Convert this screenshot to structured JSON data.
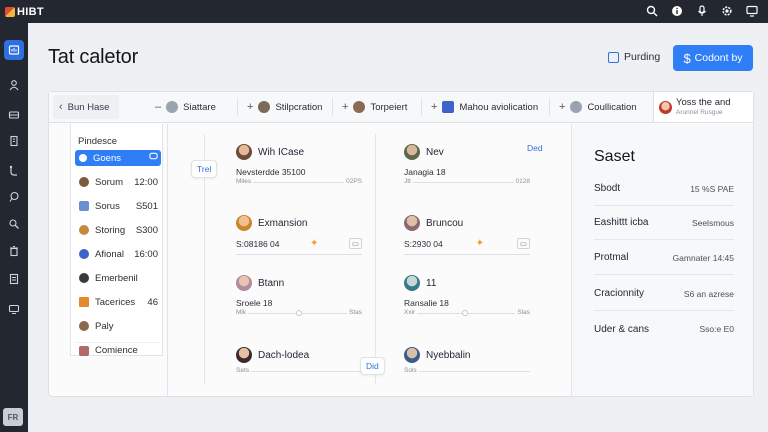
{
  "app": {
    "brand": "HIBT"
  },
  "topbar_icons": [
    "search-icon",
    "info-icon",
    "microphone-icon",
    "settings-icon",
    "monitor-icon"
  ],
  "rail": {
    "items": [
      "dashboard-icon",
      "user-icon",
      "inbox-icon",
      "building-icon",
      "route-icon",
      "chat-icon",
      "search-people-icon",
      "trash-icon",
      "document-icon",
      "display-icon"
    ],
    "bottom_label": "FR"
  },
  "header": {
    "title": "Tat caletor",
    "pending_label": "Purding",
    "primary_button": "Codont by"
  },
  "tabs": [
    {
      "label": "Bun Hase",
      "icon": "none"
    },
    {
      "label": "Siattare",
      "icon": "avatar"
    },
    {
      "label": "Stilpcration",
      "icon": "avatar"
    },
    {
      "label": "Torpeiert",
      "icon": "avatar"
    },
    {
      "label": "Mahou aviolication",
      "icon": "avatar"
    },
    {
      "label": "Coullication",
      "icon": "none"
    }
  ],
  "tab_active": {
    "title": "Yoss the and",
    "subtitle": "Arunnel Rusgue"
  },
  "list": {
    "title": "Pindesce",
    "items": [
      {
        "label": "Goens",
        "value": "",
        "active": true,
        "color": "#ffffff"
      },
      {
        "label": "Sorum",
        "value": "12:00",
        "active": false,
        "color": "#7a5a3a"
      },
      {
        "label": "Sorus",
        "value": "S501",
        "active": false,
        "color": "#6a8fd0"
      },
      {
        "label": "Storing",
        "value": "S300",
        "active": false,
        "color": "#c58a3a"
      },
      {
        "label": "Afional",
        "value": "16:00",
        "active": false,
        "color": "#3d64c8"
      },
      {
        "label": "Emerbenil",
        "value": "",
        "active": false,
        "color": "#3a3a3a"
      },
      {
        "label": "Tacerices",
        "value": "46",
        "active": false,
        "color": "#e38b2a"
      },
      {
        "label": "Paly",
        "value": "",
        "active": false,
        "color": "#8a6a4a"
      },
      {
        "label": "Comience",
        "value": "",
        "active": false,
        "color": "#b06a6a"
      }
    ]
  },
  "timeline": {
    "chips": [
      "Trel",
      "Ded",
      "Did"
    ],
    "cards": [
      {
        "name": "Wih ICase",
        "meta": "Nevsterdde 35100",
        "tag": "",
        "star": false,
        "left_label": "Miles",
        "right_label": "02PS"
      },
      {
        "name": "Nev",
        "meta": "Janagia 18",
        "tag": "",
        "star": false,
        "left_label": "Jtt",
        "right_label": "0128"
      },
      {
        "name": "Exmansion",
        "meta": "S:08186 04",
        "tag": "",
        "star": true,
        "left_label": "",
        "right_label": ""
      },
      {
        "name": "Bruncou",
        "meta": "S:2930 04",
        "tag": "",
        "star": true,
        "left_label": "",
        "right_label": ""
      },
      {
        "name": "Btann",
        "meta": "Sroele 18",
        "tag": "",
        "star": false,
        "left_label": "Mik",
        "right_label": "Stas"
      },
      {
        "name": "11",
        "meta": "Ransalie 18",
        "tag": "",
        "star": false,
        "left_label": "Xxir",
        "right_label": "Slas"
      },
      {
        "name": "Dach-lodea",
        "meta": "",
        "tag": "",
        "star": false,
        "left_label": "Sets",
        "right_label": ""
      },
      {
        "name": "Nyebbalin",
        "meta": "",
        "tag": "",
        "star": false,
        "left_label": "Sols",
        "right_label": ""
      }
    ]
  },
  "details": {
    "title": "Saset",
    "rows": [
      {
        "key": "Sbodt",
        "value": "15 %S PAE"
      },
      {
        "key": "Eashittt icba",
        "value": "Seelsmous"
      },
      {
        "key": "Protmal",
        "value": "Gamnater 14:45"
      },
      {
        "key": "Cracionnity",
        "value": "S6 an azrese"
      },
      {
        "key": "Uder & cans",
        "value": "Sso:e E0"
      }
    ]
  },
  "colors": {
    "accent": "#2f7ef6",
    "topbar": "#23272f",
    "star": "#f0a020"
  }
}
